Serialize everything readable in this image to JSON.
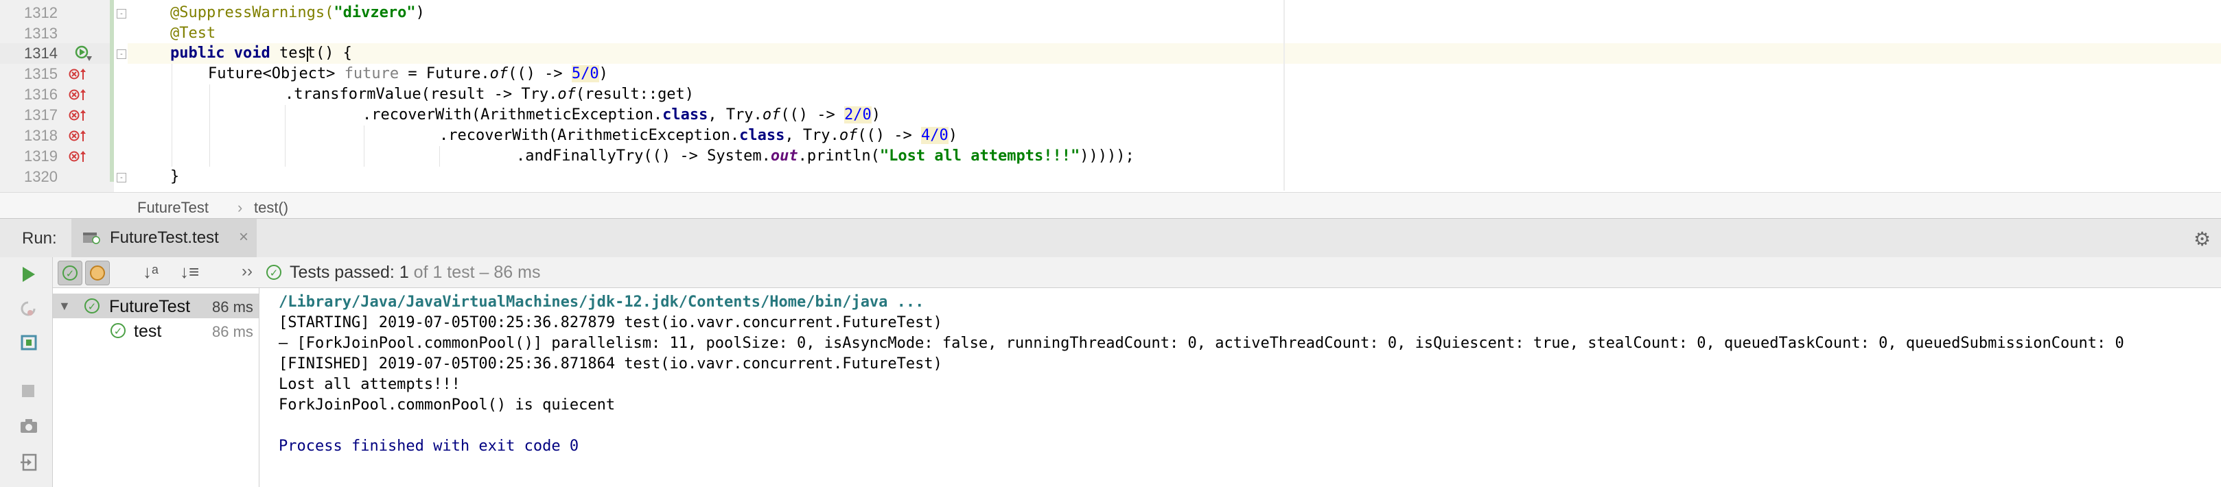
{
  "editor": {
    "line_numbers": [
      "1312",
      "1313",
      "1314",
      "1315",
      "1316",
      "1317",
      "1318",
      "1319",
      "1320"
    ],
    "code": {
      "l1312": {
        "ann": "@SuppressWarnings(",
        "str": "\"divzero\"",
        "close": ")"
      },
      "l1313": {
        "ann": "@Test"
      },
      "l1314": {
        "kw": "public void ",
        "name": "test",
        "rest": "() {"
      },
      "l1315": {
        "a": "Future<Object> ",
        "b": "future",
        "c": " = Future.",
        "d": "of",
        "e": "(() -> ",
        "f": "5/0",
        "g": ")"
      },
      "l1316": {
        "a": ".transformValue(result -> Try.",
        "b": "of",
        "c": "(result::get)"
      },
      "l1317": {
        "a": ".recoverWith(ArithmeticException.",
        "b": "class",
        "c": ", Try.",
        "d": "of",
        "e": "(() -> ",
        "f": "2/0",
        "g": ")"
      },
      "l1318": {
        "a": ".recoverWith(ArithmeticException.",
        "b": "class",
        "c": ", Try.",
        "d": "of",
        "e": "(() -> ",
        "f": "4/0",
        "g": ")"
      },
      "l1319": {
        "a": ".andFinallyTry(() -> System.",
        "b": "out",
        "c": ".println(",
        "d": "\"Lost all attempts!!!\"",
        "e": ")))));"
      },
      "l1320": {
        "a": "}"
      }
    }
  },
  "breadcrumb": {
    "class": "FutureTest",
    "separator": "›",
    "method": "test()"
  },
  "run_panel": {
    "label": "Run:",
    "tab": "FutureTest.test",
    "tab_close": "×",
    "status_prefix": "Tests passed: ",
    "status_count": "1",
    "status_suffix": " of 1 test – 86 ms",
    "more": "››"
  },
  "tree": {
    "items": [
      {
        "label": "FutureTest",
        "time": "86 ms"
      },
      {
        "label": "test",
        "time": "86 ms"
      }
    ]
  },
  "console": {
    "lines": [
      "/Library/Java/JavaVirtualMachines/jdk-12.jdk/Contents/Home/bin/java ...",
      "[STARTING] 2019-07-05T00:25:36.827879 test(io.vavr.concurrent.FutureTest)",
      "– [ForkJoinPool.commonPool()] parallelism: 11, poolSize: 0, isAsyncMode: false, runningThreadCount: 0, activeThreadCount: 0, isQuiescent: true, stealCount: 0, queuedTaskCount: 0, queuedSubmissionCount: 0",
      "[FINISHED] 2019-07-05T00:25:36.871864 test(io.vavr.concurrent.FutureTest)",
      "Lost all attempts!!!",
      "ForkJoinPool.commonPool() is quiecent",
      "Process finished with exit code 0"
    ]
  },
  "colors": {
    "pass": "#4ba045",
    "error": "#d23c3c",
    "keyword": "#000080",
    "annotation": "#808000",
    "string": "#008000"
  }
}
